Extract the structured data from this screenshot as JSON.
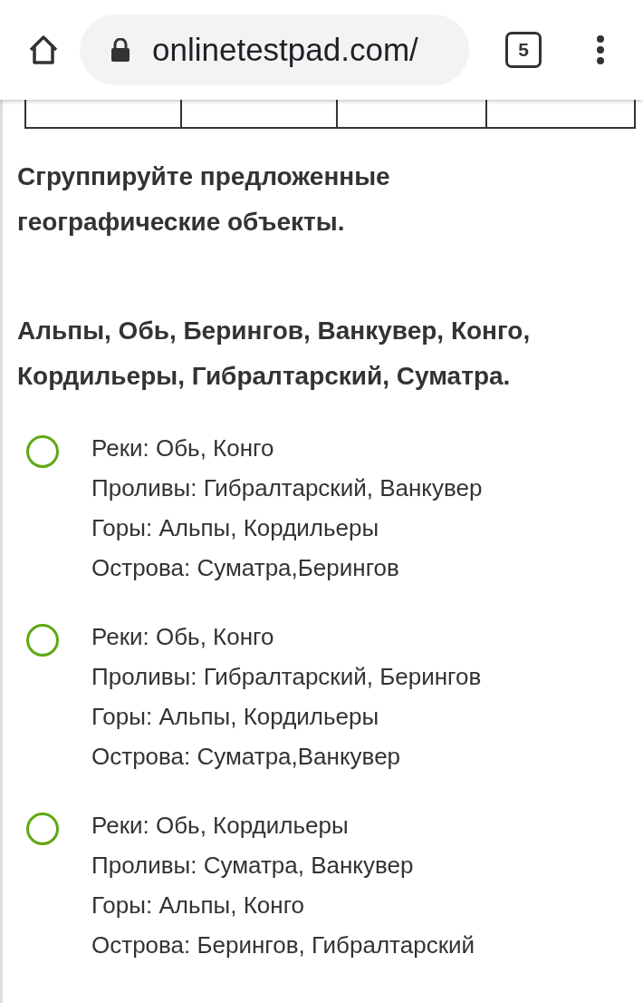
{
  "browser": {
    "url": "onlinetestpad.com/",
    "tab_count": "5"
  },
  "question": {
    "prompt": "Сгруппируйте предложенные географические объекты.",
    "items": "Альпы, Обь, Берингов, Ванкувер, Конго, Кордильеры, Гибралтарский, Суматра."
  },
  "options": [
    {
      "selected": false,
      "lines": [
        "Реки: Обь, Конго",
        "Проливы: Гибралтарский, Ванкувер",
        "Горы: Альпы, Кордильеры",
        "Острова: Суматра,Берингов"
      ]
    },
    {
      "selected": false,
      "lines": [
        "Реки: Обь, Конго",
        "Проливы: Гибралтарский, Берингов",
        "Горы: Альпы, Кордильеры",
        "Острова: Суматра,Ванкувер"
      ]
    },
    {
      "selected": false,
      "lines": [
        "Реки: Обь, Кордильеры",
        "Проливы: Суматра, Ванкувер",
        "Горы: Альпы, Конго",
        "Острова: Берингов, Гибралтарский"
      ]
    }
  ]
}
